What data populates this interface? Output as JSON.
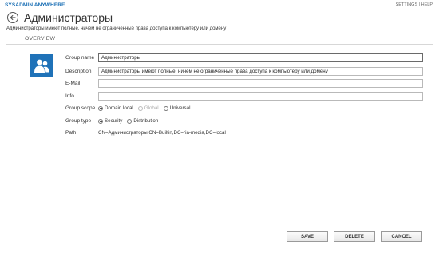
{
  "app": {
    "brand": "SYSADMIN ANYWHERE"
  },
  "toplinks": {
    "settings": "SETTINGS",
    "sep": "|",
    "help": "HELP"
  },
  "header": {
    "title": "Администраторы",
    "subtitle": "Администраторы имеют полные, ничем не ограниченные права доступа к компьютеру или домену",
    "section": "OVERVIEW"
  },
  "form": {
    "group_name": {
      "label": "Group name",
      "value": "Администраторы"
    },
    "description": {
      "label": "Description",
      "value": "Администраторы имеют полные, ничем не ограниченные права доступа к компьютеру или домену"
    },
    "email": {
      "label": "E-Mail",
      "value": ""
    },
    "info": {
      "label": "Info",
      "value": ""
    },
    "group_scope": {
      "label": "Group scope",
      "options": [
        "Domain local",
        "Global",
        "Universal"
      ],
      "selected": "Domain local",
      "disabled": [
        "Global"
      ]
    },
    "group_type": {
      "label": "Group type",
      "options": [
        "Security",
        "Distribution"
      ],
      "selected": "Security"
    },
    "path": {
      "label": "Path",
      "value": "CN=Администраторы,CN=Builtin,DC=ria-media,DC=local"
    }
  },
  "buttons": {
    "save": "SAVE",
    "delete": "DELETE",
    "cancel": "CANCEL"
  },
  "colors": {
    "accent": "#1a6fb5",
    "group_icon_bg": "#1f72b8"
  },
  "icons": {
    "back": "back-arrow-icon",
    "group": "group-users-icon"
  }
}
